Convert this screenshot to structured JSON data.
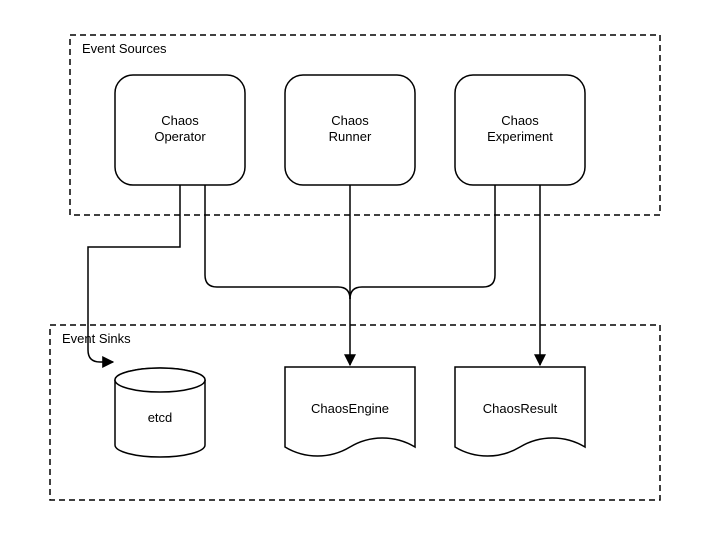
{
  "groups": {
    "sources_title": "Event Sources",
    "sinks_title": "Event Sinks"
  },
  "sources": {
    "operator_l1": "Chaos",
    "operator_l2": "Operator",
    "runner_l1": "Chaos",
    "runner_l2": "Runner",
    "experiment_l1": "Chaos",
    "experiment_l2": "Experiment"
  },
  "sinks": {
    "etcd": "etcd",
    "engine": "ChaosEngine",
    "result": "ChaosResult"
  }
}
